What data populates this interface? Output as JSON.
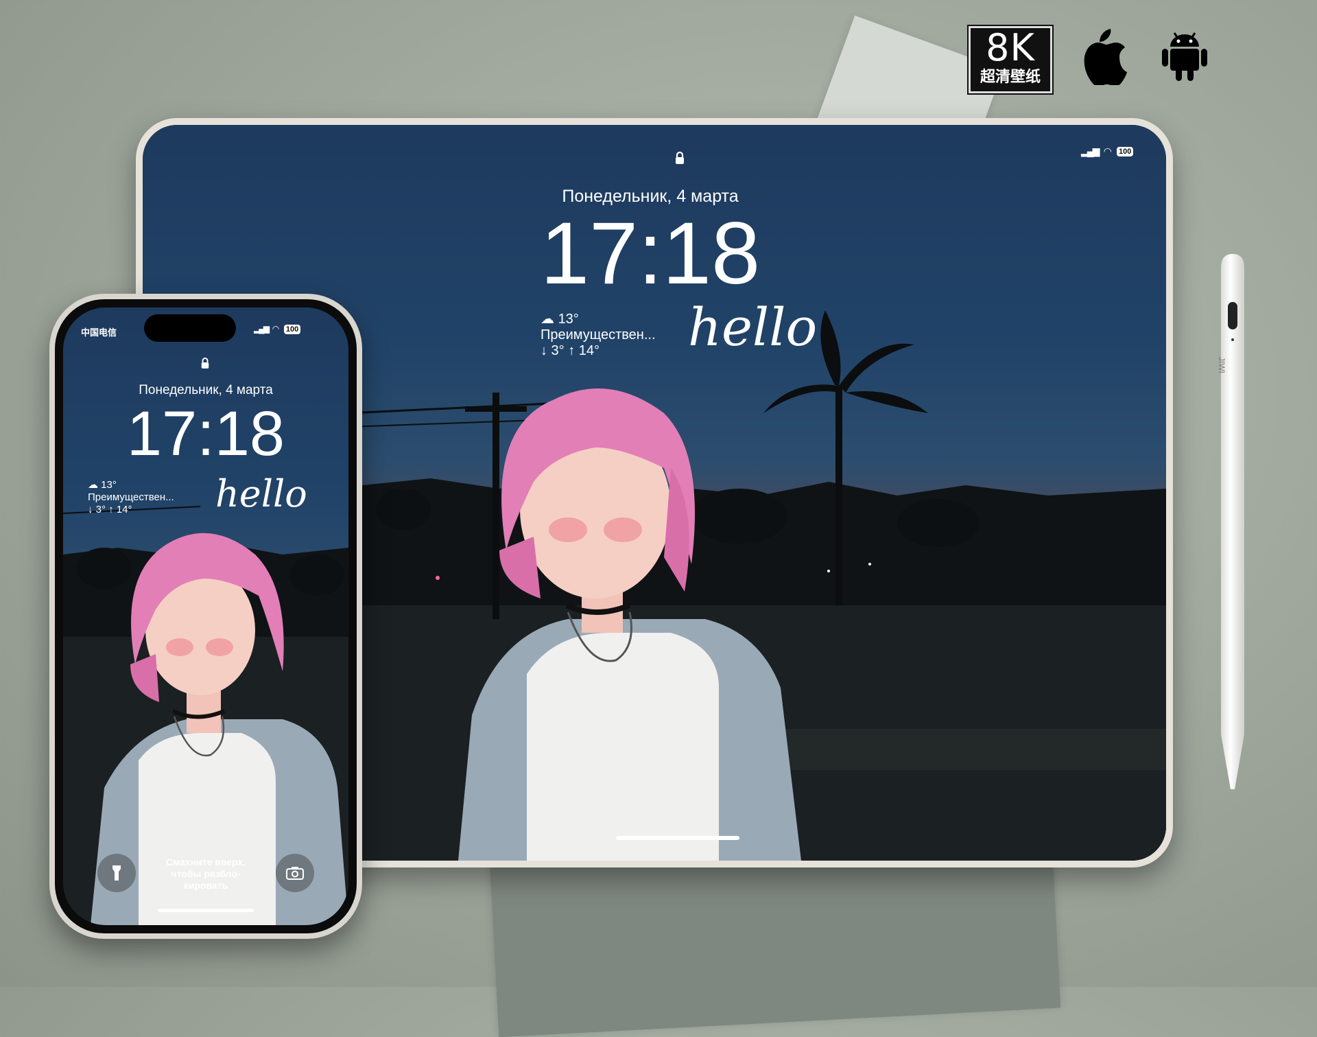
{
  "badge": {
    "resolution": "8K",
    "subtitle": "超清壁纸"
  },
  "platform_icons": [
    "apple-icon",
    "android-icon"
  ],
  "lockscreen": {
    "date": "Понедельник, 4 марта",
    "time": "17:18",
    "weather_temp": "13°",
    "weather_desc": "Преимуществен...",
    "weather_range": "↓ 3° ↑ 14°",
    "greeting": "hello",
    "unlock_hint": "Смахните вверх, чтобы разбло-кировать"
  },
  "phone_status": {
    "carrier": "中国电信",
    "battery": "100"
  },
  "tablet_status": {
    "battery": "100"
  },
  "pencil_brand": "JIWI",
  "colors": {
    "hair": "#e27fb6",
    "sky": "#214368",
    "sunset": "#b06a48"
  }
}
